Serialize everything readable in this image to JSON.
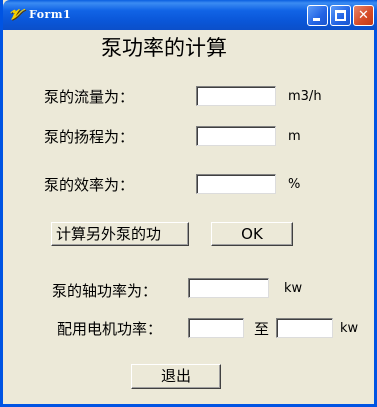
{
  "window": {
    "title": "Form1",
    "icon": "vb-form-icon"
  },
  "heading": "泵功率的计算",
  "flow": {
    "label": "泵的流量为：",
    "value": "",
    "unit": "m3/h"
  },
  "head": {
    "label": "泵的扬程为：",
    "value": "",
    "unit": "m"
  },
  "efficiency": {
    "label": "泵的效率为：",
    "value": "",
    "unit": "%"
  },
  "buttons": {
    "other_pump": "计算另外泵的功",
    "ok": "OK",
    "exit": "退出"
  },
  "shaft_power": {
    "label": "泵的轴功率为：",
    "value": "",
    "unit": "kw"
  },
  "motor_power": {
    "label": "配用电机功率：",
    "from_value": "",
    "to_label": "至",
    "to_value": "",
    "unit": "kw"
  }
}
